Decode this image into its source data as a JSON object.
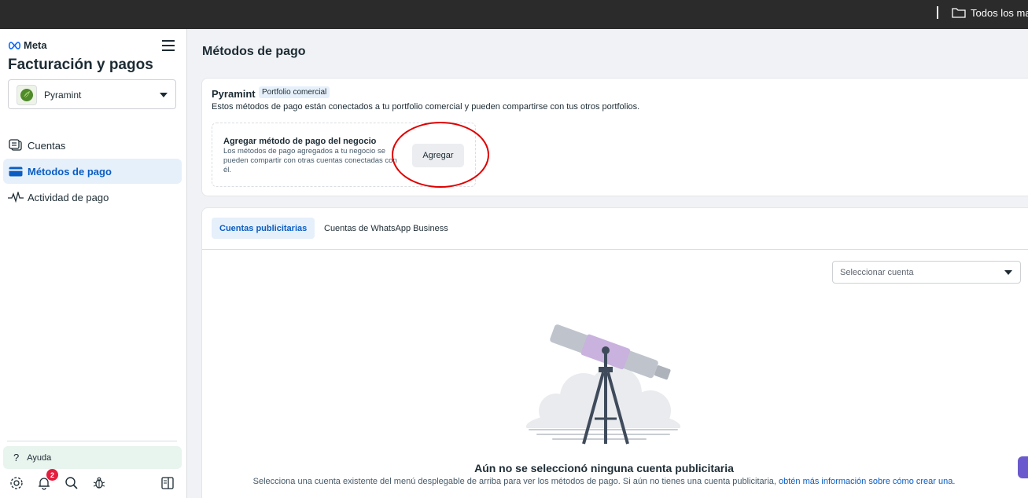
{
  "topbar": {
    "folder_label": "Todos los mar"
  },
  "sidebar": {
    "logo_text": "Meta",
    "title": "Facturación y pagos",
    "business": {
      "name": "Pyramint"
    },
    "nav": [
      {
        "label": "Cuentas",
        "icon": "accounts-icon",
        "active": false
      },
      {
        "label": "Métodos de pago",
        "icon": "credit-card-icon",
        "active": true
      },
      {
        "label": "Actividad de pago",
        "icon": "activity-icon",
        "active": false
      }
    ],
    "help": {
      "icon_text": "?",
      "label": "Ayuda"
    },
    "notifications_count": "2"
  },
  "main": {
    "page_title": "Métodos de pago",
    "portfolio": {
      "name": "Pyramint",
      "tag": "Portfolio comercial",
      "description": "Estos métodos de pago están conectados a tu portfolio comercial y pueden compartirse con tus otros portfolios.",
      "add_box": {
        "title": "Agregar método de pago del negocio",
        "description": "Los métodos de pago agregados a tu negocio se pueden compartir con otras cuentas conectadas con él.",
        "button_label": "Agregar"
      }
    },
    "accounts": {
      "tabs": [
        {
          "label": "Cuentas publicitarias",
          "active": true
        },
        {
          "label": "Cuentas de WhatsApp Business",
          "active": false
        }
      ],
      "select_placeholder": "Seleccionar cuenta",
      "empty_title": "Aún no se seleccionó ninguna cuenta publicitaria",
      "empty_desc": "Selecciona una cuenta existente del menú desplegable de arriba para ver los métodos de pago. Si aún no tienes una cuenta publicitaria, ",
      "empty_link": "obtén más información sobre cómo crear una."
    }
  },
  "colors": {
    "accent": "#0a5dc2",
    "active_bg": "#e6f0fb",
    "highlight_circle": "#e00000",
    "badge": "#e41e3f"
  }
}
